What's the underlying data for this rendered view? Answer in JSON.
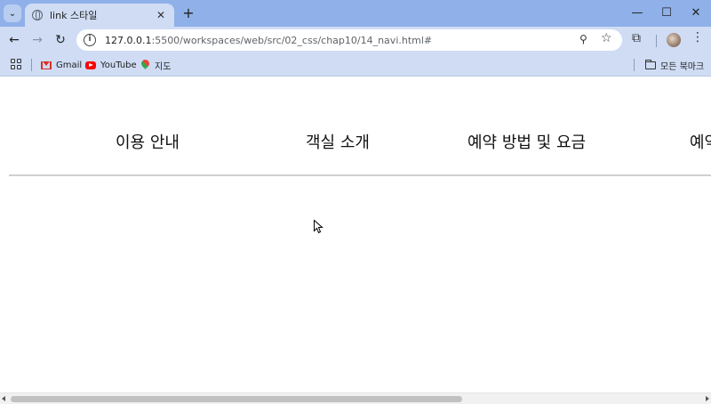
{
  "browser": {
    "tab_title": "link 스타일",
    "tab_close": "✕",
    "new_tab": "+",
    "win_min": "—",
    "win_max": "☐",
    "win_close": "✕",
    "url_host": "127.0.0.1",
    "url_path": ":5500/workspaces/web/src/02_css/chap10/14_navi.html#",
    "nav_back": "←",
    "nav_forward": "→",
    "nav_reload": "↻",
    "site_info": "i",
    "zoom": "⚲",
    "star": "☆",
    "extensions": "⧉",
    "menu": "⋮",
    "tab_search": "⌄"
  },
  "bookmarks": {
    "gmail": "Gmail",
    "youtube": "YouTube",
    "maps": "지도",
    "all": "모든 북마크"
  },
  "nav_menu": {
    "items": [
      "이용 안내",
      "객실 소개",
      "예약 방법 및 요금",
      "예약"
    ]
  },
  "colors": {
    "tab_strip": "#8fb0e8",
    "toolbar": "#cfdcf4",
    "divider": "#d0d0d0"
  }
}
